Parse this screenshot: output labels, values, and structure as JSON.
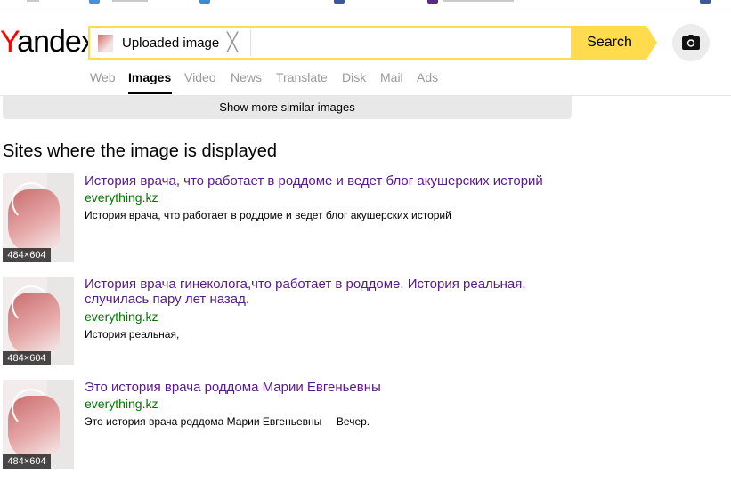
{
  "header": {
    "logo": "andex",
    "logo_first": "Y",
    "search": {
      "uploaded_label": "Uploaded image",
      "clear_glyph": "╳",
      "button_label": "Search"
    },
    "tabs": [
      "Web",
      "Images",
      "Video",
      "News",
      "Translate",
      "Disk",
      "Mail",
      "Ads"
    ],
    "active_tab": "Images"
  },
  "similar": {
    "more_label": "Show more similar images"
  },
  "sites": {
    "title": "Sites where the image is displayed",
    "results": [
      {
        "title": "История врача, что работает в роддоме и ведет блог акушерских историй",
        "site": "everything.kz",
        "description": "История врача, что работает в роддоме и ведет блог акушерских историй",
        "dims": "484×604"
      },
      {
        "title": "История врача гинеколога,что работает в роддоме. История реальная, случилась пару лет назад.",
        "site": "everything.kz",
        "description": "История реальная,",
        "dims": "484×604"
      },
      {
        "title": "Это история врача роддома Марии Евгеньевны",
        "site": "everything.kz",
        "description": "Это история врача роддома Марии Евгеньевны     Вечер.",
        "dims": "484×604"
      }
    ]
  },
  "colors": {
    "accent": "#ffdb4d",
    "link": "#551a8b",
    "site": "#007700",
    "logo_red": "#ff0000"
  }
}
